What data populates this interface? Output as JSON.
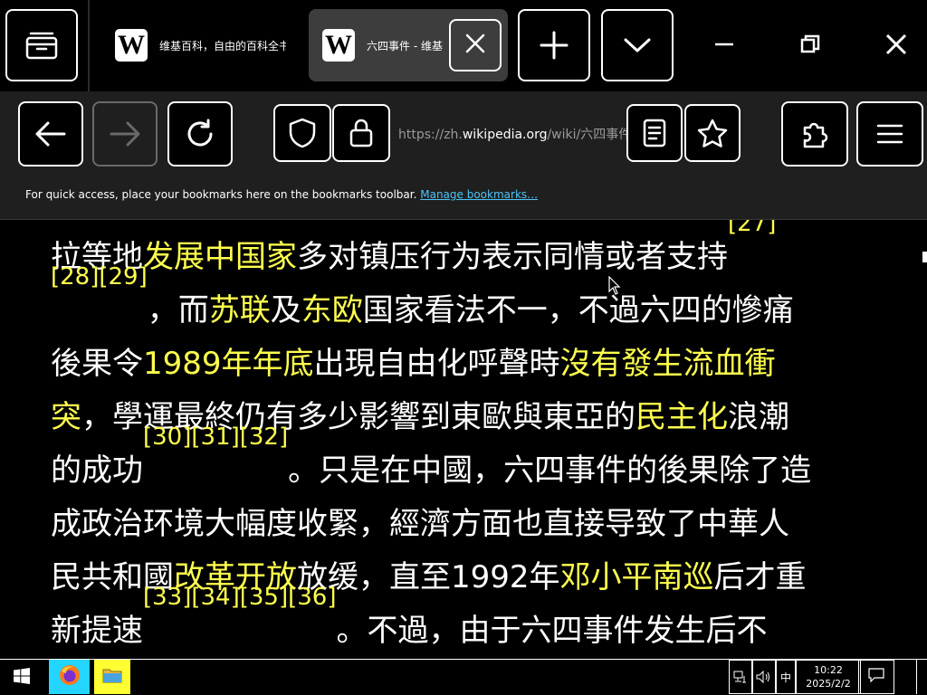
{
  "browser": {
    "tabs": [
      {
        "title": "维基百科，自由的百科全书",
        "favicon": "W",
        "active": false
      },
      {
        "title": "六四事件 - 维基百科",
        "favicon": "W",
        "active": true
      }
    ],
    "url": {
      "scheme": "https://zh.",
      "domain": "wikipedia.org",
      "path": "/wiki/六四事件"
    },
    "bookmarks_bar": {
      "message": "For quick access, place your bookmarks here on the bookmarks toolbar.",
      "manage_link": "Manage bookmarks…"
    },
    "icons": {
      "tab_group": "tab-group-icon",
      "close_tab": "close-icon",
      "new_tab": "plus-icon",
      "tab_list": "chevron-down-icon",
      "minimize": "minimize-icon",
      "restore": "restore-icon",
      "close_window": "close-icon",
      "back": "arrow-left-icon",
      "forward": "arrow-right-icon",
      "reload": "reload-icon",
      "tracking_protection": "shield-icon",
      "security": "lock-icon",
      "reader_view": "reader-icon",
      "bookmark": "star-icon",
      "extensions": "puzzle-icon",
      "menu": "hamburger-icon"
    }
  },
  "article": {
    "lines": [
      [
        {
          "t": "拉等地"
        },
        {
          "t": "发展中国家",
          "link": true
        },
        {
          "t": "多对镇压行为表示同情或者支持"
        },
        {
          "t": "[27]",
          "ref": true
        }
      ],
      [
        {
          "t": "[28]",
          "ref": true
        },
        {
          "t": "[29]",
          "ref": true
        },
        {
          "t": "，而"
        },
        {
          "t": "苏联",
          "link": true
        },
        {
          "t": "及"
        },
        {
          "t": "东欧",
          "link": true
        },
        {
          "t": "国家看法不一，不過六四的慘痛"
        }
      ],
      [
        {
          "t": "後果令"
        },
        {
          "t": "1989年年底",
          "link": true
        },
        {
          "t": "出現自由化呼聲時"
        },
        {
          "t": "沒有發生流血衝",
          "link": true
        }
      ],
      [
        {
          "t": "突",
          "link": true
        },
        {
          "t": "，學運最終仍有多少影響到東歐與東亞的"
        },
        {
          "t": "民主化",
          "link": true
        },
        {
          "t": "浪潮"
        }
      ],
      [
        {
          "t": "的成功"
        },
        {
          "t": "[30]",
          "ref": true
        },
        {
          "t": "[31]",
          "ref": true
        },
        {
          "t": "[32]",
          "ref": true
        },
        {
          "t": "。只是在中國，六四事件的後果除了造"
        }
      ],
      [
        {
          "t": "成政治环境大幅度收緊，經濟方面也直接导致了中華人"
        }
      ],
      [
        {
          "t": "民共和國"
        },
        {
          "t": "改革开放",
          "link": true
        },
        {
          "t": "放缓，直至1992年"
        },
        {
          "t": "邓小平南巡",
          "link": true
        },
        {
          "t": "后才重"
        }
      ],
      [
        {
          "t": "新提速"
        },
        {
          "t": "[33]",
          "ref": true
        },
        {
          "t": "[34]",
          "ref": true
        },
        {
          "t": "[35]",
          "ref": true
        },
        {
          "t": "[36]",
          "ref": true
        },
        {
          "t": "。不過，由于六四事件发生后不"
        }
      ]
    ],
    "colors": {
      "text": "#ffffff",
      "link": "#ffff4d",
      "background": "#000000"
    }
  },
  "taskbar": {
    "apps": [
      {
        "name": "Firefox",
        "icon": "firefox-icon"
      },
      {
        "name": "File Explorer",
        "icon": "folder-icon"
      }
    ],
    "ime": "中",
    "time": "10:22",
    "date": "2025/2/2",
    "colors": {
      "firefox_bg": "#23d5ff",
      "explorer_bg": "#ffff33"
    }
  }
}
